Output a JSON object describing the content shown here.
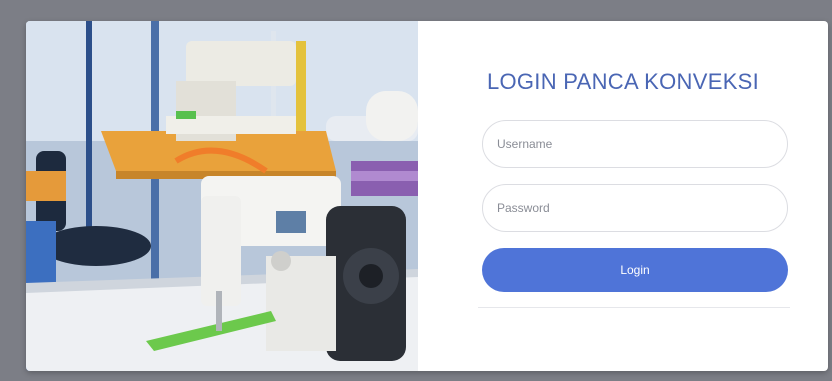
{
  "login": {
    "title": "LOGIN PANCA KONVEKSI",
    "username_placeholder": "Username",
    "password_placeholder": "Password",
    "username_value": "",
    "password_value": "",
    "button_label": "Login"
  },
  "colors": {
    "title": "#4a66b4",
    "button": "#4f74d8",
    "background": "#7c7e86"
  }
}
